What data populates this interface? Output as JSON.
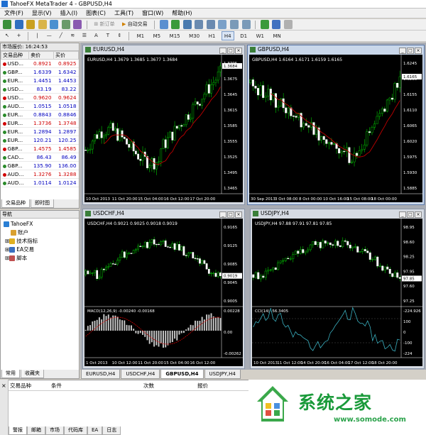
{
  "window": {
    "title": "TahoeFX MetaTrader 4 - GBPUSD,H4"
  },
  "menu": [
    "文件(F)",
    "显示(V)",
    "插入(I)",
    "图表(C)",
    "工具(T)",
    "窗口(W)",
    "帮助(H)"
  ],
  "toolbar": {
    "new_order": "新订单",
    "auto_trade": "自动交易",
    "timeframes": [
      "M1",
      "M5",
      "M15",
      "M30",
      "H1",
      "H4",
      "D1",
      "W1",
      "MN"
    ],
    "active_timeframe": "H4"
  },
  "market_watch": {
    "header": "市场报价: 16:24:53",
    "columns": [
      "交易品种",
      "卖价",
      "买价"
    ],
    "rows": [
      {
        "symbol": "USD...",
        "bid": "0.8921",
        "ask": "0.8925",
        "color": "red"
      },
      {
        "symbol": "GBP...",
        "bid": "1.6339",
        "ask": "1.6342",
        "color": "blue"
      },
      {
        "symbol": "EUR...",
        "bid": "1.4451",
        "ask": "1.4453",
        "color": "blue"
      },
      {
        "symbol": "USD...",
        "bid": "83.19",
        "ask": "83.22",
        "color": "blue"
      },
      {
        "symbol": "USD...",
        "bid": "0.9620",
        "ask": "0.9624",
        "color": "red"
      },
      {
        "symbol": "AUD...",
        "bid": "1.0515",
        "ask": "1.0518",
        "color": "blue"
      },
      {
        "symbol": "EUR...",
        "bid": "0.8843",
        "ask": "0.8846",
        "color": "blue"
      },
      {
        "symbol": "EUR...",
        "bid": "1.3736",
        "ask": "1.3748",
        "color": "red"
      },
      {
        "symbol": "EUR...",
        "bid": "1.2894",
        "ask": "1.2897",
        "color": "blue"
      },
      {
        "symbol": "EUR...",
        "bid": "120.21",
        "ask": "120.25",
        "color": "blue"
      },
      {
        "symbol": "GBP...",
        "bid": "1.4575",
        "ask": "1.4585",
        "color": "red"
      },
      {
        "symbol": "CAD...",
        "bid": "86.43",
        "ask": "86.49",
        "color": "blue"
      },
      {
        "symbol": "GBP...",
        "bid": "135.90",
        "ask": "136.00",
        "color": "blue"
      },
      {
        "symbol": "AUD...",
        "bid": "1.3276",
        "ask": "1.3288",
        "color": "red"
      },
      {
        "symbol": "AUD...",
        "bid": "1.0114",
        "ask": "1.0124",
        "color": "blue"
      }
    ],
    "tabs": [
      "交易品种",
      "即时图"
    ]
  },
  "navigator": {
    "header": "导航",
    "root": "TahoeFX",
    "items": [
      "账户",
      "技术指标",
      "EA交易",
      "脚本"
    ],
    "tabs": [
      "常用",
      "收藏夹"
    ]
  },
  "charts": [
    {
      "caption": "EURUSD,H4",
      "info": "EURUSD,H4  1.3679 1.3685 1.3677 1.3684",
      "price_labels": [
        "1.3705",
        "1.3675",
        "1.3645",
        "1.3615",
        "1.3585",
        "1.3555",
        "1.3525",
        "1.3495",
        "1.3465"
      ],
      "last": "1.3684",
      "time_labels": [
        "10 Oct 2013",
        "11 Oct 20:00",
        "15 Oct 04:00",
        "16 Oct 12:00",
        "17 Oct 20:00"
      ],
      "trend": "up"
    },
    {
      "caption": "GBPUSD,H4",
      "info": "GBPUSD,H4  1.6164 1.6171 1.6159 1.6165",
      "price_labels": [
        "1.6245",
        "1.6200",
        "1.6155",
        "1.6110",
        "1.6065",
        "1.6020",
        "1.5975",
        "1.5930",
        "1.5885"
      ],
      "last": "1.6165",
      "time_labels": [
        "30 Sep 2013",
        "3 Oct 08:00",
        "8 Oct 00:00",
        "10 Oct 16:00",
        "15 Oct 08:00",
        "18 Oct 00:00"
      ],
      "trend": "v"
    },
    {
      "caption": "USDCHF,H4",
      "info": "USDCHF,H4  0.9021 0.9025 0.9018 0.9019",
      "price_labels": [
        "0.9165",
        "0.9125",
        "0.9085",
        "0.9045",
        "0.9005"
      ],
      "last": "0.9019",
      "indicator_label": "MACD(12,26,9) -0.00240 -0.00168",
      "indicator_scale": [
        "0.00228",
        "0.00",
        "-0.00262"
      ],
      "time_labels": [
        "1 Oct 2013",
        "10 Oct 12:00",
        "11 Oct 20:00",
        "15 Oct 04:00",
        "16 Oct 12:00"
      ],
      "trend": "hump"
    },
    {
      "caption": "USDJPY,H4",
      "info": "USDJPY,H4  97.88 97.91 97.81 97.85",
      "price_labels": [
        "98.95",
        "98.60",
        "98.25",
        "97.95",
        "97.60",
        "97.25"
      ],
      "last": "97.85",
      "indicator_label": "CCI(14) -56.3405",
      "indicator_scale": [
        "-224.926",
        "100",
        "0",
        "-100",
        "-224"
      ],
      "time_labels": [
        "10 Oct 2013",
        "11 Oct 12:00",
        "14 Oct 20:00",
        "16 Oct 04:00",
        "17 Oct 12:00",
        "18 Oct 20:00"
      ],
      "trend": "hump"
    }
  ],
  "chart_tabs": [
    "EURUSD,H4",
    "USDCHF,H4",
    "GBPUSD,H4",
    "USDJPY,H4"
  ],
  "chart_tabs_active": "GBPUSD,H4",
  "terminal": {
    "columns": [
      "交易品种",
      "条件",
      "次数",
      "报价"
    ],
    "tabs": [
      "警报",
      "邮箱",
      "市场",
      "代码库",
      "EA",
      "日志"
    ]
  },
  "watermark": {
    "text": "系统之家",
    "url": "www.somode.com"
  },
  "colors": {
    "bull": "#00c800",
    "bear": "#ffffff",
    "ma": "#c00000",
    "indicator_line": "#3ab0c0"
  }
}
